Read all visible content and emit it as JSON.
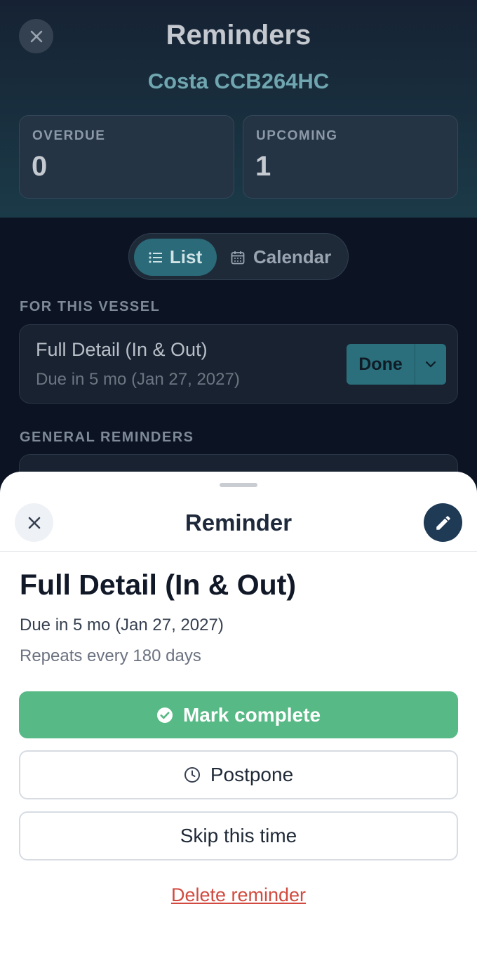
{
  "background": {
    "title": "Reminders",
    "vessel_name": "Costa CCB264HC",
    "stats": {
      "overdue_label": "OVERDUE",
      "overdue_value": "0",
      "upcoming_label": "UPCOMING",
      "upcoming_value": "1"
    },
    "view_toggle": {
      "list_label": "List",
      "calendar_label": "Calendar",
      "selected": "List"
    },
    "section_vessel": "FOR THIS VESSEL",
    "vessel_item": {
      "title": "Full Detail (In & Out)",
      "due": "Due in 5 mo (Jan 27, 2027)",
      "done_label": "Done"
    },
    "section_general": "GENERAL REMINDERS"
  },
  "sheet": {
    "title": "Reminder",
    "reminder_title": "Full Detail (In & Out)",
    "due_text": "Due in 5 mo (Jan 27, 2027)",
    "repeat_text": "Repeats every 180 days",
    "mark_complete_label": "Mark complete",
    "postpone_label": "Postpone",
    "skip_label": "Skip this time",
    "delete_label": "Delete reminder"
  },
  "colors": {
    "accent_green": "#57b985",
    "accent_teal": "#2b6f7d",
    "edit_button": "#1e3a54",
    "danger": "#d24a3f"
  },
  "icons": {
    "close": "close-icon",
    "edit": "pencil-icon",
    "complete": "check-circle-icon",
    "postpone": "clock-icon",
    "list": "list-icon",
    "calendar": "calendar-icon",
    "dropdown": "chevron-down-icon"
  }
}
